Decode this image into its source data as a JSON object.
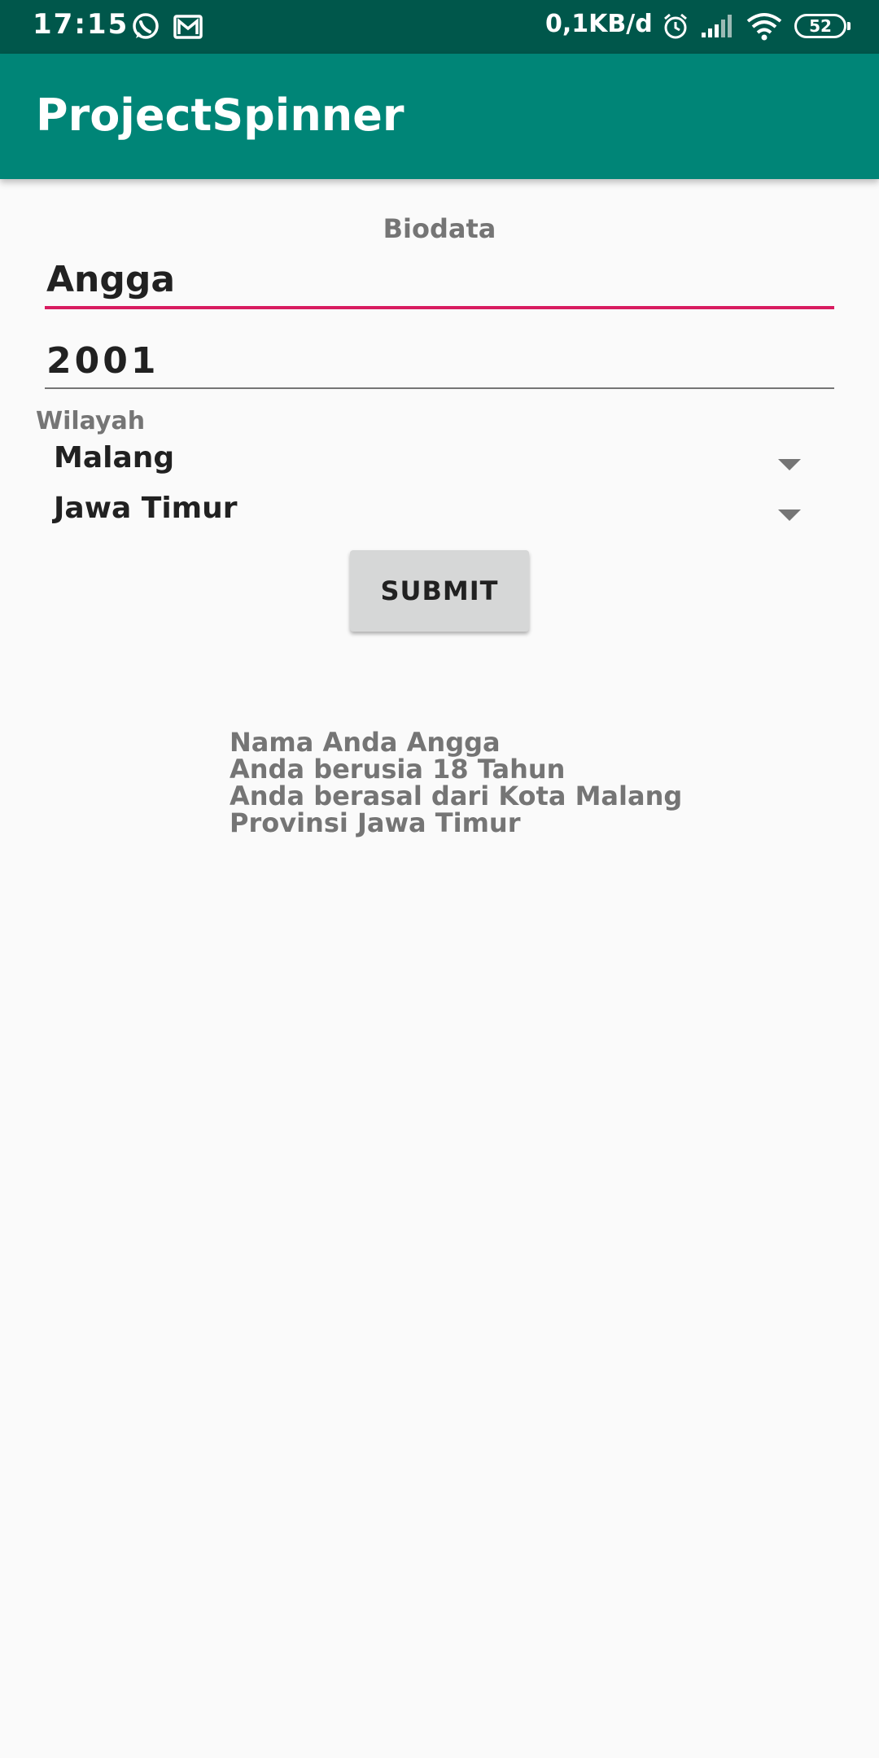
{
  "status_bar": {
    "time": "17:15",
    "net_speed": "0,1KB/d",
    "battery": "52",
    "icons": [
      "whatsapp-icon",
      "gmail-icon",
      "alarm-icon",
      "signal-icon",
      "wifi-icon",
      "battery-icon"
    ]
  },
  "app_bar": {
    "title": "ProjectSpinner"
  },
  "form": {
    "heading": "Biodata",
    "name_value": "Angga",
    "year_value": "2001",
    "region_label": "Wilayah",
    "city_selected": "Malang",
    "province_selected": "Jawa Timur",
    "submit_label": "SUBMIT"
  },
  "result": {
    "line1": "Nama Anda Angga",
    "line2": "Anda berusia 18 Tahun",
    "line3": "Anda berasal dari Kota Malang",
    "line4": "Provinsi Jawa Timur"
  },
  "colors": {
    "status_bar": "#00574b",
    "app_bar": "#008577",
    "accent": "#d81b60",
    "button": "#d6d7d7"
  }
}
